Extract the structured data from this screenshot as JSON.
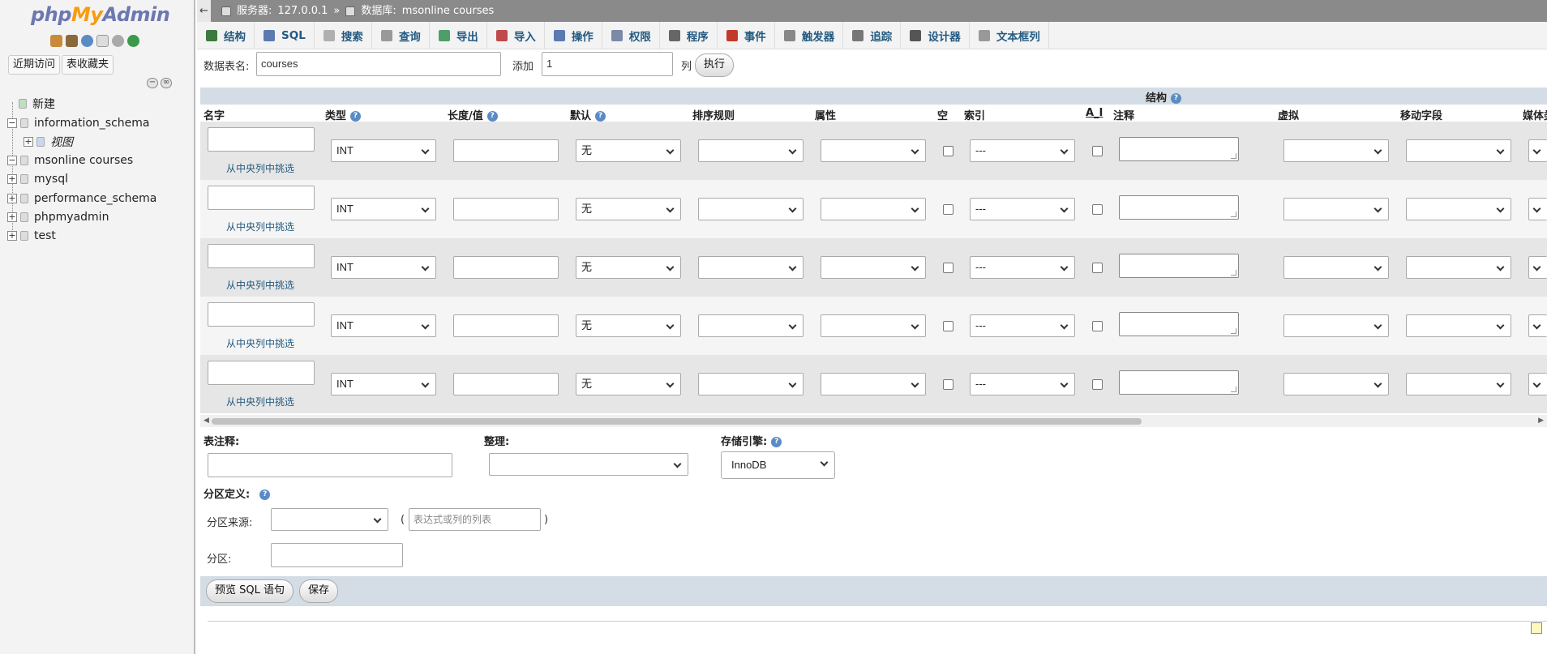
{
  "sidebar": {
    "logo_php": "php",
    "logo_my": "My",
    "logo_admin": "Admin",
    "recent_label": "近期访问",
    "favorites_label": "表收藏夹",
    "tree": [
      {
        "label": "新建",
        "toggle": ""
      },
      {
        "label": "information_schema",
        "toggle": "−"
      },
      {
        "label": "视图",
        "toggle": "+"
      },
      {
        "label": "msonline courses",
        "toggle": "−"
      },
      {
        "label": "mysql",
        "toggle": "+"
      },
      {
        "label": "performance_schema",
        "toggle": "+"
      },
      {
        "label": "phpmyadmin",
        "toggle": "+"
      },
      {
        "label": "test",
        "toggle": "+"
      }
    ]
  },
  "breadcrumb": {
    "server_label": "服务器:",
    "server_value": "127.0.0.1",
    "sep": "»",
    "db_label": "数据库:",
    "db_value": "msonline courses"
  },
  "tabs": [
    {
      "label": "结构",
      "color": "#3d7a3d"
    },
    {
      "label": "SQL",
      "color": "#5a7ab0"
    },
    {
      "label": "搜索",
      "color": "#b0b0b0"
    },
    {
      "label": "查询",
      "color": "#999999"
    },
    {
      "label": "导出",
      "color": "#4e9e6a"
    },
    {
      "label": "导入",
      "color": "#c04a4a"
    },
    {
      "label": "操作",
      "color": "#5a7ab0"
    },
    {
      "label": "权限",
      "color": "#7a8aa8"
    },
    {
      "label": "程序",
      "color": "#666666"
    },
    {
      "label": "事件",
      "color": "#c43a2a"
    },
    {
      "label": "触发器",
      "color": "#888888"
    },
    {
      "label": "追踪",
      "color": "#777777"
    },
    {
      "label": "设计器",
      "color": "#555555"
    },
    {
      "label": "文本框列",
      "color": "#999999"
    }
  ],
  "tablename": {
    "label": "数据表名:",
    "value": "courses",
    "add_label": "添加",
    "add_value": "1",
    "col_label": "列",
    "go_button": "执行"
  },
  "structure": {
    "title": "结构",
    "columns": [
      "名字",
      "类型",
      "长度/值",
      "默认",
      "排序规则",
      "属性",
      "空",
      "索引",
      "A_I",
      "注释",
      "虚拟",
      "移动字段",
      "媒体类"
    ],
    "type_value": "INT",
    "default_value": "无",
    "index_value": "---",
    "from_central": "从中央列中挑选",
    "row_count": 5
  },
  "table_options": {
    "comment_label": "表注释:",
    "collation_label": "整理:",
    "engine_label": "存储引擎:",
    "engine_value": "InnoDB"
  },
  "partition": {
    "title": "分区定义:",
    "source_label": "分区来源:",
    "paren_open": "(",
    "expr_placeholder": "表达式或列的列表",
    "paren_close": ")",
    "partitions_label": "分区:"
  },
  "footer": {
    "preview_button": "预览 SQL 语句",
    "save_button": "保存"
  }
}
